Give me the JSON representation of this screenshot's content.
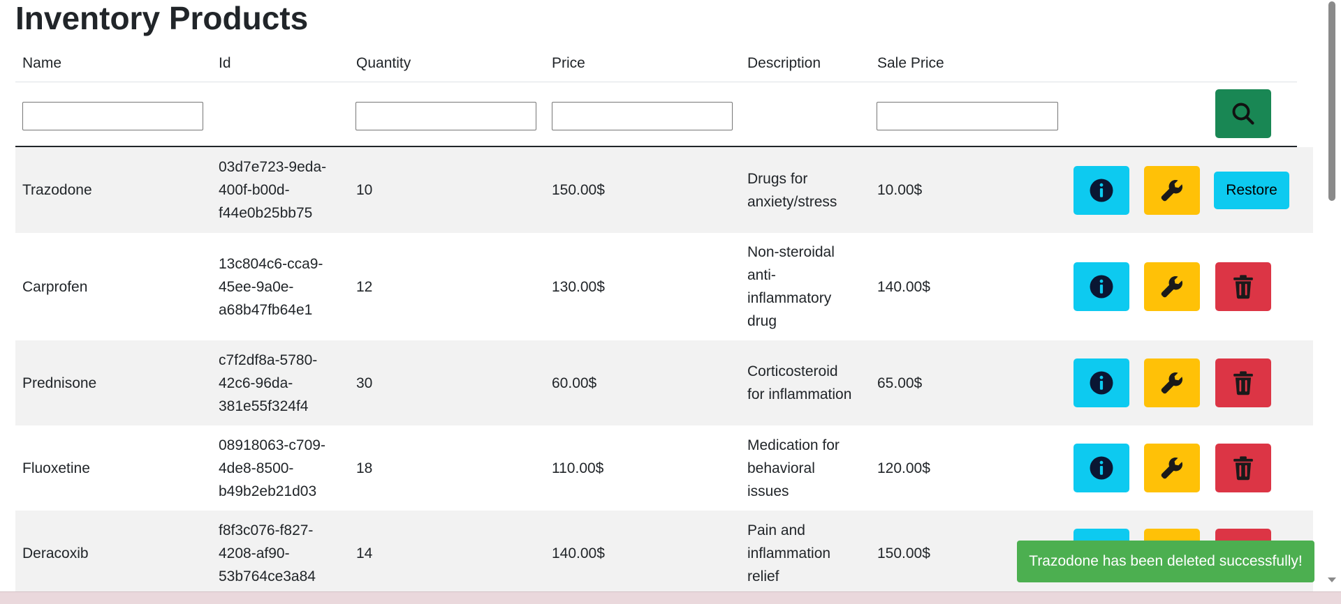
{
  "page": {
    "title": "Inventory Products"
  },
  "table": {
    "columns": [
      "Name",
      "Id",
      "Quantity",
      "Price",
      "Description",
      "Sale Price"
    ],
    "rows": [
      {
        "name": "Trazodone",
        "id": "03d7e723-9eda-\n400f-b00d-\nf44e0b25bb75",
        "quantity": "10",
        "price": "150.00$",
        "description": "Drugs for\nanxiety/stress",
        "sale_price": "10.00$",
        "third_action": "restore",
        "restore_label": "Restore"
      },
      {
        "name": "Carprofen",
        "id": "13c804c6-cca9-\n45ee-9a0e-\na68b47fb64e1",
        "quantity": "12",
        "price": "130.00$",
        "description": "Non-steroidal\nanti-\ninflammatory\ndrug",
        "sale_price": "140.00$",
        "third_action": "delete"
      },
      {
        "name": "Prednisone",
        "id": "c7f2df8a-5780-\n42c6-96da-\n381e55f324f4",
        "quantity": "30",
        "price": "60.00$",
        "description": "Corticosteroid\nfor inflammation",
        "sale_price": "65.00$",
        "third_action": "delete"
      },
      {
        "name": "Fluoxetine",
        "id": "08918063-c709-\n4de8-8500-\nb49b2eb21d03",
        "quantity": "18",
        "price": "110.00$",
        "description": "Medication for\nbehavioral\nissues",
        "sale_price": "120.00$",
        "third_action": "delete"
      },
      {
        "name": "Deracoxib",
        "id": "f8f3c076-f827-\n4208-af90-\n53b764ce3a84",
        "quantity": "14",
        "price": "140.00$",
        "description": "Pain and\ninflammation\nrelief",
        "sale_price": "150.00$",
        "third_action": "delete"
      }
    ]
  },
  "toast": {
    "message": "Trazodone has been deleted successfully!"
  },
  "icons": {
    "search": "search-icon",
    "info": "info-icon",
    "edit": "wrench-icon",
    "delete": "trash-icon"
  },
  "colors": {
    "info": "#0dcaf0",
    "edit": "#ffc107",
    "delete": "#dc3545",
    "search": "#198754",
    "toast": "#4caf50"
  }
}
